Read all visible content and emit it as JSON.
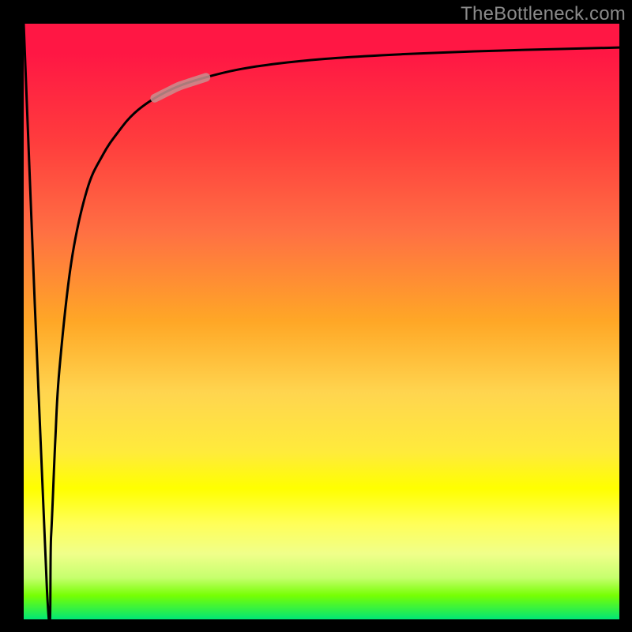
{
  "watermark": "TheBottleneck.com",
  "chart_data": {
    "type": "line",
    "title": "",
    "xlabel": "",
    "ylabel": "",
    "xlim": [
      0,
      100
    ],
    "ylim": [
      0,
      100
    ],
    "grid": false,
    "legend": false,
    "series": [
      {
        "name": "bottleneck-curve",
        "x": [
          0.0,
          3.9,
          4.6,
          5.3,
          6.0,
          8.0,
          10.6,
          13.3,
          16.0,
          18.6,
          22.0,
          26.0,
          30.6,
          36.0,
          42.6,
          50.6,
          60.0,
          71.3,
          84.0,
          100.0
        ],
        "y": [
          100.0,
          5.0,
          14.0,
          30.0,
          42.0,
          60.0,
          72.0,
          78.0,
          82.0,
          85.0,
          87.5,
          89.5,
          91.0,
          92.3,
          93.3,
          94.1,
          94.7,
          95.2,
          95.6,
          96.0
        ]
      }
    ],
    "annotations": [
      {
        "name": "highlight-segment",
        "x_range": [
          22.0,
          30.6
        ],
        "style": "thick-muted"
      }
    ],
    "background": {
      "type": "vertical-gradient",
      "stops": [
        {
          "pos": 0.0,
          "color": "#ff1744"
        },
        {
          "pos": 0.5,
          "color": "#ffa726"
        },
        {
          "pos": 0.78,
          "color": "#ffff00"
        },
        {
          "pos": 1.0,
          "color": "#00e676"
        }
      ]
    }
  }
}
